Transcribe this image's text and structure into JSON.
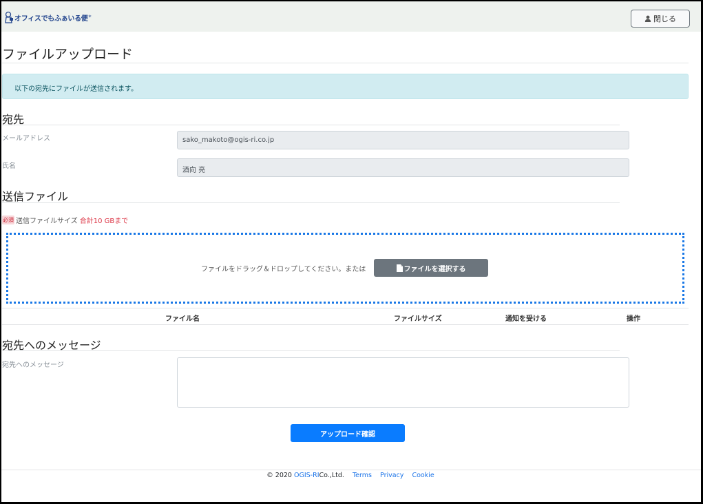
{
  "header": {
    "logo_text": "オフィスでもふぁいる便",
    "close_label": "閉じる"
  },
  "page": {
    "title": "ファイルアップロード",
    "alert": "以下の宛先にファイルが送信されます。"
  },
  "recipient": {
    "section_title": "宛先",
    "email_label": "メールアドレス",
    "email_value": "sako_makoto@ogis-ri.co.jp",
    "name_label": "氏名",
    "name_value": "酒向 亮"
  },
  "files": {
    "section_title": "送信ファイル",
    "required_badge": "必須",
    "size_label": "送信ファイルサイズ",
    "size_limit": "合計10 GBまで",
    "drop_text": "ファイルをドラッグ＆ドロップしてください。または",
    "select_button": "ファイルを選択する",
    "columns": {
      "name": "ファイル名",
      "size": "ファイルサイズ",
      "notify": "通知を受ける",
      "action": "操作"
    }
  },
  "message": {
    "section_title": "宛先へのメッセージ",
    "label": "宛先へのメッセージ",
    "value": ""
  },
  "submit_button": "アップロード確認",
  "footer": {
    "copyright": "© 2020",
    "company_link": "OGIS-RI",
    "company_suffix": "Co.,Ltd.",
    "terms": "Terms",
    "privacy": "Privacy",
    "cookie": "Cookie"
  },
  "colors": {
    "primary": "#0a7cff",
    "alert_bg": "#d1ecf1",
    "dropzone_border": "#1877e6",
    "required": "#dc3545"
  }
}
